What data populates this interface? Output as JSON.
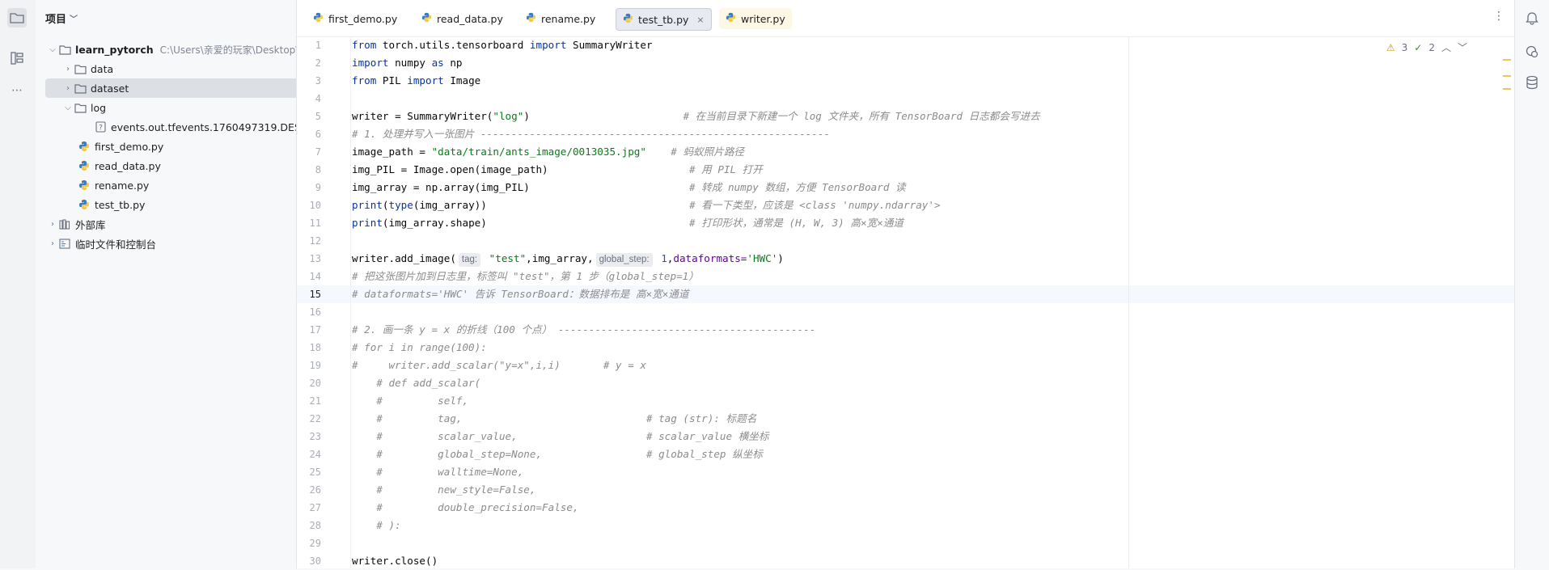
{
  "project_panel": {
    "title": "项目",
    "tree": [
      {
        "label": "learn_pytorch",
        "hint": "C:\\Users\\亲爱的玩家\\Desktop\\p",
        "kind": "folder",
        "level": 0,
        "open": true
      },
      {
        "label": "data",
        "kind": "folder",
        "level": 1,
        "open": false
      },
      {
        "label": "dataset",
        "kind": "folder",
        "level": 1,
        "open": false,
        "selected": true
      },
      {
        "label": "log",
        "kind": "folder",
        "level": 1,
        "open": true
      },
      {
        "label": "events.out.tfevents.1760497319.DESKTO",
        "kind": "unknown-file",
        "level": 2
      },
      {
        "label": "first_demo.py",
        "kind": "python",
        "level": 1
      },
      {
        "label": "read_data.py",
        "kind": "python",
        "level": 1
      },
      {
        "label": "rename.py",
        "kind": "python",
        "level": 1
      },
      {
        "label": "test_tb.py",
        "kind": "python",
        "level": 1
      },
      {
        "label": "外部库",
        "kind": "library",
        "level": 0,
        "open": false
      },
      {
        "label": "临时文件和控制台",
        "kind": "scratch",
        "level": 0,
        "open": false
      }
    ]
  },
  "tabs": [
    {
      "label": "first_demo.py",
      "active": false
    },
    {
      "label": "read_data.py",
      "active": false
    },
    {
      "label": "rename.py",
      "active": false
    },
    {
      "label": "test_tb.py",
      "active": true,
      "close": "×"
    },
    {
      "label": "writer.py",
      "active": false,
      "modified": true
    }
  ],
  "inspections": {
    "warnings": "3",
    "ok": "2"
  },
  "current_line": 15,
  "line_numbers": [
    "1",
    "2",
    "3",
    "4",
    "5",
    "6",
    "7",
    "8",
    "9",
    "10",
    "11",
    "12",
    "13",
    "14",
    "15",
    "16",
    "17",
    "18",
    "19",
    "20",
    "21",
    "22",
    "23",
    "24",
    "25",
    "26",
    "27",
    "28",
    "29",
    "30"
  ],
  "code": {
    "l1": {
      "a": "from",
      "b": " torch.utils.tensorboard ",
      "c": "import",
      "d": " SummaryWriter"
    },
    "l2": {
      "a": "import",
      "b": " numpy ",
      "c": "as",
      "d": " np"
    },
    "l3": {
      "a": "from",
      "b": " PIL ",
      "c": "import",
      "d": " Image"
    },
    "l5": {
      "a": "writer = SummaryWriter(",
      "b": "\"log\"",
      "c": ")                         ",
      "d": "# 在当前目录下新建一个 log 文件夹，所有 TensorBoard 日志都会写进去"
    },
    "l6": {
      "a": "# 1. 处理并写入一张图片 ---------------------------------------------------------"
    },
    "l7": {
      "a": "image_path = ",
      "b": "\"data/train/ants_image/0013035.jpg\"",
      "c": "    ",
      "d": "# 蚂蚁照片路径"
    },
    "l8": {
      "a": "img_PIL = Image.open(image_path)                       ",
      "b": "# 用 PIL 打开"
    },
    "l9": {
      "a": "img_array = np.array(img_PIL)                          ",
      "b": "# 转成 numpy 数组，方便 TensorBoard 读"
    },
    "l10": {
      "a": "print",
      "b": "(",
      "c": "type",
      "d": "(img_array))                                 ",
      "e": "# 看一下类型，应该是 <class 'numpy.ndarray'>"
    },
    "l11": {
      "a": "print",
      "b": "(img_array.shape)                                 ",
      "c": "# 打印形状，通常是 (H, W, 3) 高×宽×通道"
    },
    "l13": {
      "a": "writer.add_image(",
      "h1": "tag:",
      "b": " \"test\"",
      "c": ",img_array,",
      "h2": "global_step:",
      "d": " 1",
      "e": ",",
      "f": "dataformats=",
      "g": "'HWC'",
      "h": ")"
    },
    "l14": {
      "a": "# 把这张图片加到日志里，标签叫 \"test\"，第 1 步（global_step=1）"
    },
    "l15": {
      "a": "# dataformats='HWC' 告诉 TensorBoard：数据排布是 高×宽×通道"
    },
    "l17": {
      "a": "# 2. 画一条 y = x 的折线（100 个点） ------------------------------------------"
    },
    "l18": {
      "a": "# for i in range(100):"
    },
    "l19": {
      "a": "#     writer.add_scalar(\"y=x\",i,i)       # y = x"
    },
    "l20": {
      "a": "    # def add_scalar("
    },
    "l21": {
      "a": "    #         self,"
    },
    "l22": {
      "a": "    #         tag,                              # tag (str): 标题名"
    },
    "l23": {
      "a": "    #         scalar_value,                     # scalar_value 横坐标"
    },
    "l24": {
      "a": "    #         global_step=None,                 # global_step 纵坐标"
    },
    "l25": {
      "a": "    #         walltime=None,"
    },
    "l26": {
      "a": "    #         new_style=False,"
    },
    "l27": {
      "a": "    #         double_precision=False,"
    },
    "l28": {
      "a": "    # ):"
    },
    "l30": {
      "a": "writer.close()"
    }
  },
  "colors": {
    "keyword": "#0033b3",
    "string": "#067d17",
    "number": "#1750eb",
    "comment": "#8c8c8c",
    "selection": "#dcdfe4"
  }
}
